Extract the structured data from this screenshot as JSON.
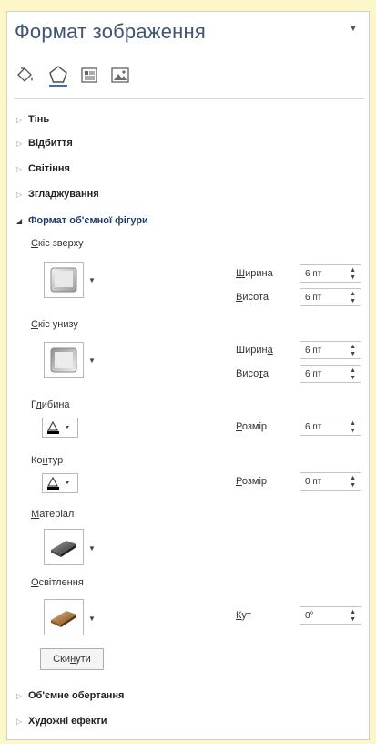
{
  "pane": {
    "title": "Формат зображення",
    "menu_icon": "chevron-down-icon",
    "tabs": [
      {
        "icon": "fill-line-icon"
      },
      {
        "icon": "effects-pentagon-icon"
      },
      {
        "icon": "layout-properties-icon"
      },
      {
        "icon": "picture-icon"
      }
    ]
  },
  "sections": {
    "shadow": "Тінь",
    "reflection": "Відбиття",
    "glow": "Світіння",
    "soft_edges": "Згладжування",
    "format_3d": "Формат об'ємної фігури",
    "rotation_3d": "Об'ємне обертання",
    "artistic_effects": "Художні ефекти"
  },
  "format3d": {
    "top_bevel": {
      "label_first": "С",
      "label_rest": "кіс зверху",
      "width_label_first": "Ш",
      "width_label_rest": "ирина",
      "width_value": "6 пт",
      "height_label_first": "В",
      "height_label_rest": "исота",
      "height_value": "6 пт"
    },
    "bottom_bevel": {
      "label_first": "С",
      "label_rest": "кіс унизу",
      "width_label_start": "Ширин",
      "width_label_u": "а",
      "width_value": "6 пт",
      "height_label_start": "Висо",
      "height_label_u": "т",
      "height_label_end": "а",
      "height_value": "6 пт"
    },
    "depth": {
      "label_start": "Г",
      "label_u": "л",
      "label_end": "ибина",
      "size_label_first": "Р",
      "size_label_rest": "озмір",
      "size_value": "6 пт",
      "color": "#000000"
    },
    "contour": {
      "label_start": "Ко",
      "label_u": "н",
      "label_end": "тур",
      "size_label_first": "Р",
      "size_label_rest": "озмір",
      "size_value": "0 пт",
      "color": "#000000"
    },
    "material": {
      "label_first": "М",
      "label_rest": "атеріал"
    },
    "lighting": {
      "label_first": "О",
      "label_rest": "світлення",
      "angle_label_first": "К",
      "angle_label_rest": "ут",
      "angle_value": "0°"
    },
    "reset": {
      "label_start": "Ски",
      "label_u": "н",
      "label_end": "ути"
    }
  },
  "colors": {
    "title": "#3f5673",
    "background_page": "#fcf7c8"
  }
}
